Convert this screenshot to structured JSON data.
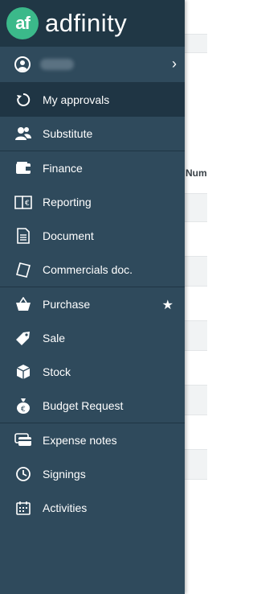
{
  "brand": {
    "logo_mark": "af",
    "name": "adfinity",
    "accent_color": "#3bb98a"
  },
  "user": {
    "icon": "user-circle-icon"
  },
  "background": {
    "column_header": "Num"
  },
  "menu": {
    "items": [
      {
        "label": "My approvals",
        "icon": "refresh-icon",
        "active": true
      },
      {
        "label": "Substitute",
        "icon": "users-icon"
      },
      {
        "label": "Finance",
        "icon": "wallet-icon"
      },
      {
        "label": "Reporting",
        "icon": "euro-book-icon"
      },
      {
        "label": "Document",
        "icon": "document-icon"
      },
      {
        "label": "Commercials doc.",
        "icon": "papers-icon"
      },
      {
        "label": "Purchase",
        "icon": "basket-icon",
        "favorite": true
      },
      {
        "label": "Sale",
        "icon": "price-tag-icon"
      },
      {
        "label": "Stock",
        "icon": "box-icon"
      },
      {
        "label": "Budget Request",
        "icon": "money-bag-icon"
      },
      {
        "label": "Expense notes",
        "icon": "cards-icon"
      },
      {
        "label": "Signings",
        "icon": "clock-icon"
      },
      {
        "label": "Activities",
        "icon": "calendar-icon"
      }
    ]
  },
  "colors": {
    "drawer": "#2f4a5c",
    "drawer_header": "#203745",
    "active_item": "#1f3544"
  }
}
